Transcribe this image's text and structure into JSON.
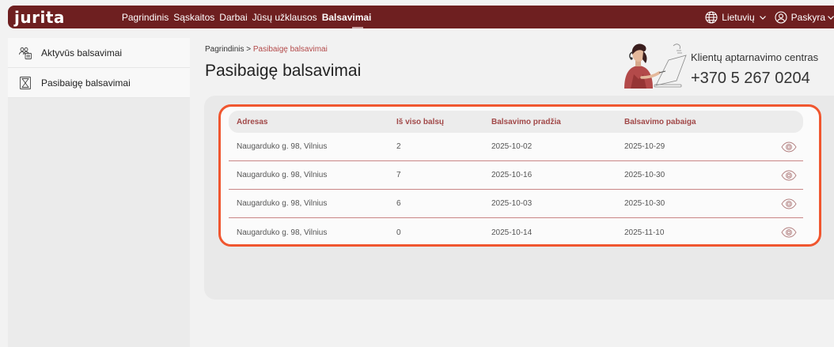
{
  "brand": {
    "logo": "jurita",
    "color": "#6e1f20",
    "accent": "#f0562f"
  },
  "nav": {
    "items": [
      {
        "label": "Pagrindinis",
        "active": false
      },
      {
        "label": "Sąskaitos",
        "active": false
      },
      {
        "label": "Darbai",
        "active": false
      },
      {
        "label": "Jūsų užklausos",
        "active": false
      },
      {
        "label": "Balsavimai",
        "active": true
      }
    ],
    "language": {
      "label": "Lietuvių",
      "icon": "globe-icon"
    },
    "account": {
      "label": "Paskyra",
      "icon": "user-icon"
    }
  },
  "sidebar": {
    "items": [
      {
        "label": "Aktyvūs balsavimai",
        "icon": "ballot-icon"
      },
      {
        "label": "Pasibaigę balsavimai",
        "icon": "hourglass-icon"
      }
    ]
  },
  "breadcrumb": {
    "root": "Pagrindinis",
    "separator": ">",
    "current": "Pasibaigę balsavimai"
  },
  "page": {
    "title": "Pasibaigę balsavimai"
  },
  "support": {
    "label": "Klientų aptarnavimo centras",
    "phone": "+370 5 267 0204"
  },
  "table": {
    "headers": [
      "Adresas",
      "Iš viso balsų",
      "Balsavimo pradžia",
      "Balsavimo pabaiga"
    ],
    "rows": [
      {
        "address": "Naugarduko g. 98, Vilnius",
        "votes": "2",
        "start": "2025-10-02",
        "end": "2025-10-29"
      },
      {
        "address": "Naugarduko g. 98, Vilnius",
        "votes": "7",
        "start": "2025-10-16",
        "end": "2025-10-30"
      },
      {
        "address": "Naugarduko g. 98, Vilnius",
        "votes": "6",
        "start": "2025-10-03",
        "end": "2025-10-30"
      },
      {
        "address": "Naugarduko g. 98, Vilnius",
        "votes": "0",
        "start": "2025-10-14",
        "end": "2025-11-10"
      }
    ],
    "row_action_icon": "eye-icon"
  }
}
